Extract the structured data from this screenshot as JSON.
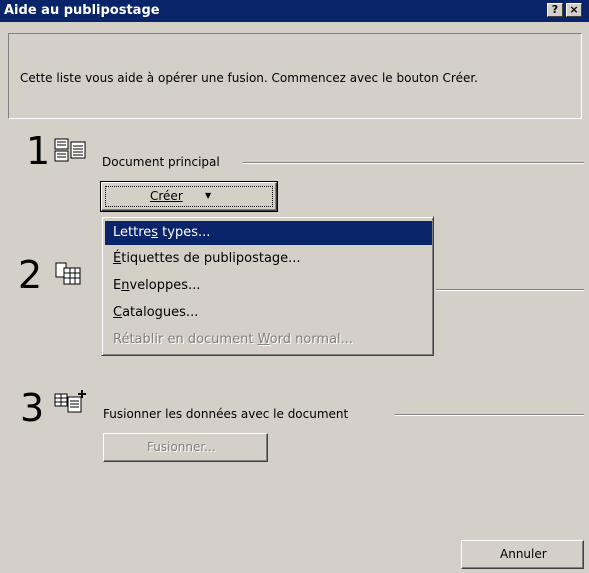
{
  "window": {
    "title": "Aide au publipostage",
    "help_label": "?",
    "close_label": "×"
  },
  "intro": {
    "text": "Cette liste vous aide à opérer une fusion. Commencez avec le bouton Créer."
  },
  "step1": {
    "number": "1",
    "label": "Document principal",
    "button_label": "Créer",
    "button_arrow": "▼"
  },
  "step2": {
    "number": "2"
  },
  "step3": {
    "number": "3",
    "label": "Fusionner les données avec le document",
    "button_label": "Fusionner..."
  },
  "menu": {
    "items": [
      {
        "pre": "Lettre",
        "key": "s",
        "post": " types...",
        "state": "selected"
      },
      {
        "pre": "",
        "key": "É",
        "post": "tiquettes de publipostage...",
        "state": "normal"
      },
      {
        "pre": "E",
        "key": "n",
        "post": "veloppes...",
        "state": "normal"
      },
      {
        "pre": "",
        "key": "C",
        "post": "atalogues...",
        "state": "normal"
      },
      {
        "pre": "Rétablir en document ",
        "key": "W",
        "post": "ord normal...",
        "state": "disabled"
      }
    ]
  },
  "footer": {
    "cancel_label": "Annuler"
  },
  "icons": {
    "step1": "main-document-icon",
    "step2": "data-source-icon",
    "step3": "merge-icon"
  }
}
